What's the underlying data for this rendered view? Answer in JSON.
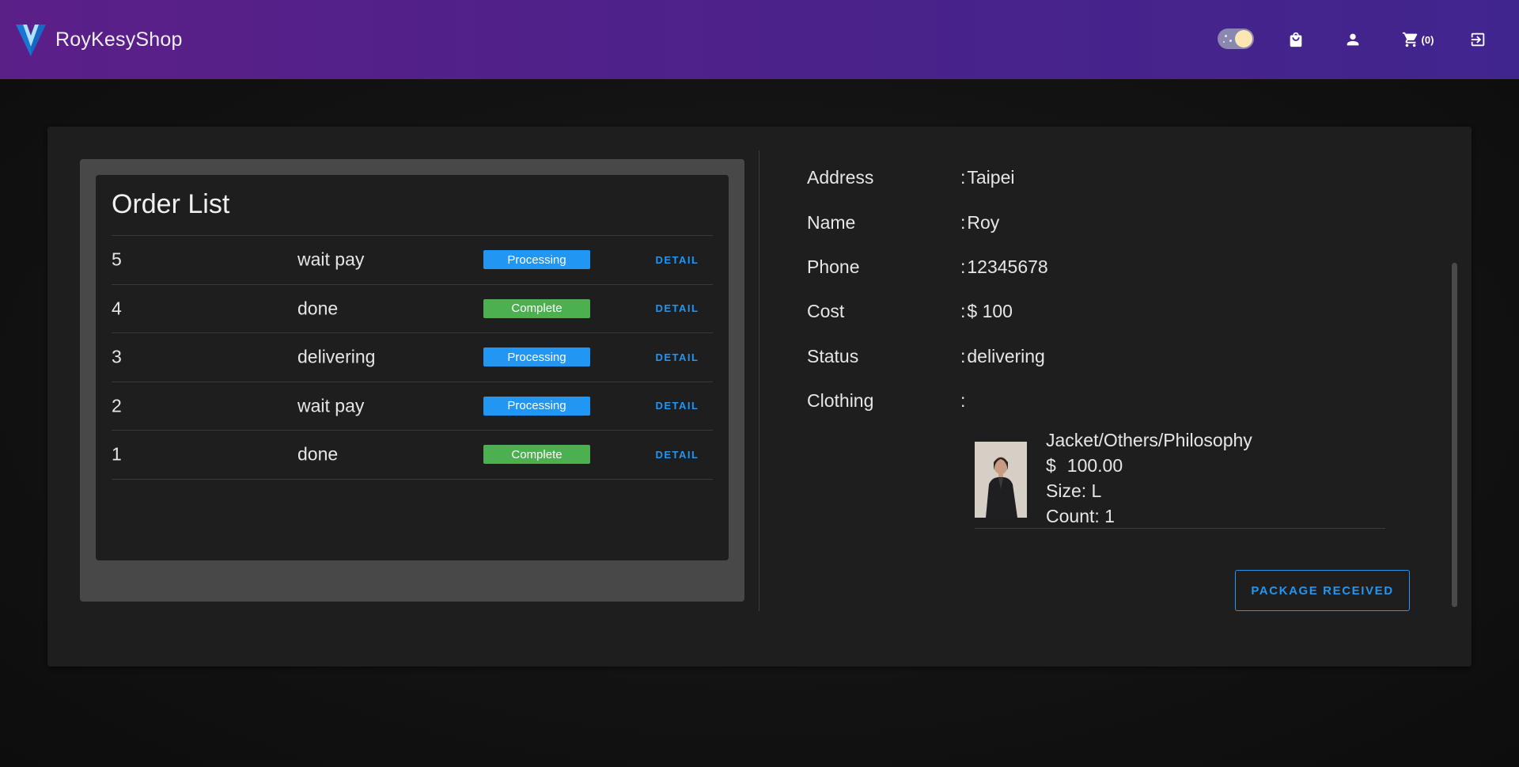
{
  "header": {
    "brand_name": "RoyKesyShop",
    "cart_count": "(0)",
    "icons": [
      "vuetify-logo-icon",
      "theme-toggle",
      "shopping-bag-icon",
      "account-icon",
      "cart-icon",
      "logout-icon"
    ]
  },
  "colors": {
    "header_start": "#5b1f88",
    "header_end": "#41258e",
    "accent": "#2196f3",
    "processing": "#2196f3",
    "complete": "#4caf50"
  },
  "order_list": {
    "title": "Order List",
    "detail_label": "DETAIL",
    "orders": [
      {
        "id": "5",
        "state": "wait pay",
        "badge": "Processing",
        "badge_color": "#2196f3"
      },
      {
        "id": "4",
        "state": "done",
        "badge": "Complete",
        "badge_color": "#4caf50"
      },
      {
        "id": "3",
        "state": "delivering",
        "badge": "Processing",
        "badge_color": "#2196f3"
      },
      {
        "id": "2",
        "state": "wait pay",
        "badge": "Processing",
        "badge_color": "#2196f3"
      },
      {
        "id": "1",
        "state": "done",
        "badge": "Complete",
        "badge_color": "#4caf50"
      }
    ]
  },
  "detail": {
    "address_label": "Address",
    "address_value": "Taipei",
    "name_label": "Name",
    "name_value": "Roy",
    "phone_label": "Phone",
    "phone_value": "12345678",
    "cost_label": "Cost",
    "cost_value": "$ 100",
    "status_label": "Status",
    "status_value": "delivering",
    "clothing_label": "Clothing",
    "separator": ":",
    "item": {
      "title": "Jacket/Others/Philosophy",
      "currency": "$",
      "price": "100.00",
      "size": "Size: L",
      "count": "Count: 1"
    },
    "received_button": "PACKAGE RECEIVED"
  }
}
